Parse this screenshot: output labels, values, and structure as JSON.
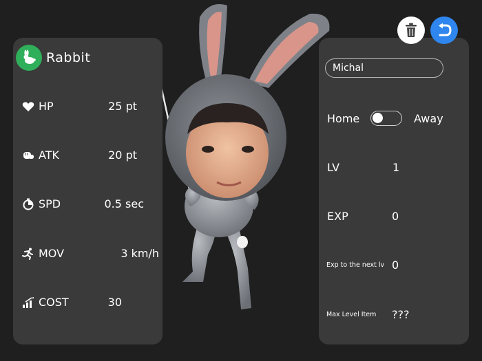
{
  "character": {
    "name": "Rabbit",
    "badge_color": "#2faf5a",
    "badge_icon": "rabbit-icon"
  },
  "stats": [
    {
      "icon": "heart-icon",
      "label": "HP",
      "value": "25 pt"
    },
    {
      "icon": "fist-icon",
      "label": "ATK",
      "value": "20 pt"
    },
    {
      "icon": "stopwatch-icon",
      "label": "SPD",
      "value": "0.5 sec"
    },
    {
      "icon": "running-icon",
      "label": "MOV",
      "value": "3 km/h"
    },
    {
      "icon": "bar-chart-icon",
      "label": "COST",
      "value": "30"
    }
  ],
  "player": {
    "name_value": "Michal",
    "toggle_left_label": "Home",
    "toggle_right_label": "Away",
    "toggle_state": "Home",
    "lv_label": "LV",
    "lv_value": "1",
    "exp_label": "EXP",
    "exp_value": "0",
    "next_label": "Exp to the next lv",
    "next_value": "0",
    "max_label": "Max Level Item",
    "max_value": "???"
  },
  "buttons": {
    "trash_icon": "trash-icon",
    "back_icon": "back-arrow-icon",
    "back_color": "#2f86ee"
  }
}
